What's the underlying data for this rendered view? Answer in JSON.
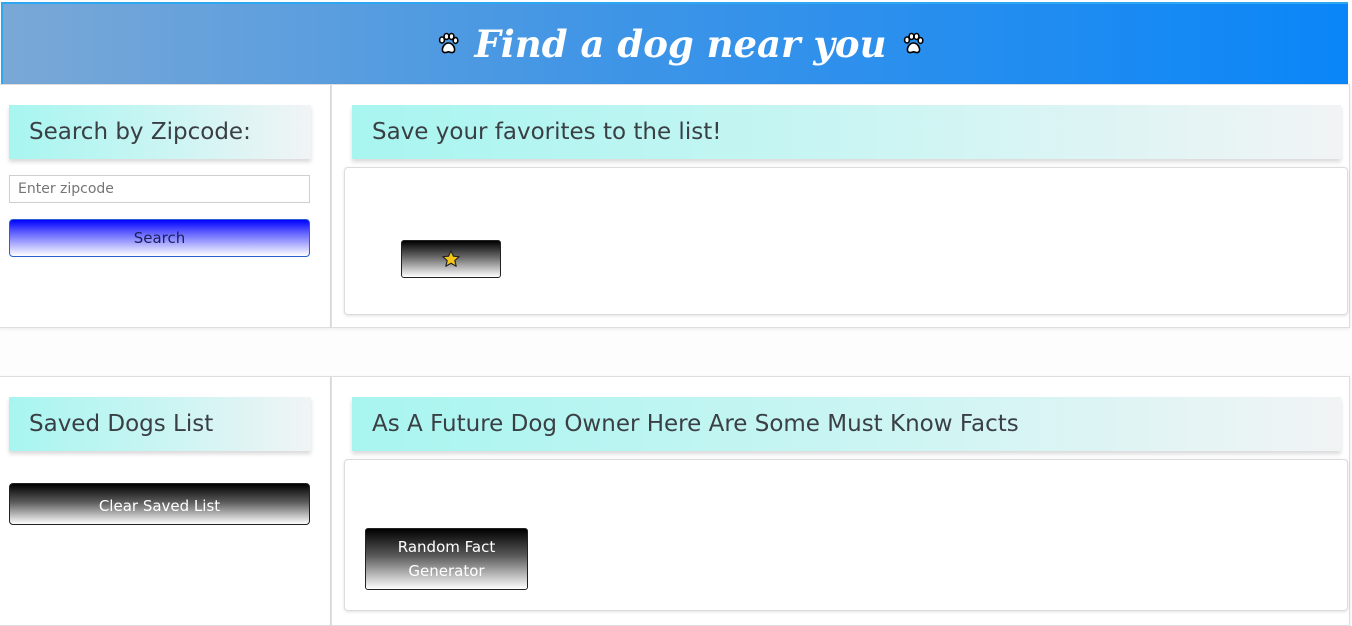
{
  "banner": {
    "title": "Find a dog near you",
    "left_icon": "paw-icon",
    "right_icon": "paw-icon"
  },
  "search_panel": {
    "heading": "Search by Zipcode:",
    "input_placeholder": "Enter zipcode",
    "input_value": "",
    "search_button_label": "Search"
  },
  "favorites_panel": {
    "heading": "Save your favorites to the list!",
    "star_icon": "star-icon"
  },
  "saved_panel": {
    "heading": "Saved Dogs List",
    "clear_button_label": "Clear Saved List"
  },
  "facts_panel": {
    "heading": "As A Future Dog Owner Here Are Some Must Know Facts",
    "fact_button_label": "Random Fact Generator"
  },
  "colors": {
    "banner_start": "#7aa8d6",
    "banner_end": "#0a86f8",
    "header_bar_start": "#a8f5f0",
    "search_button": "#0000ff",
    "star": "#f5c518"
  }
}
